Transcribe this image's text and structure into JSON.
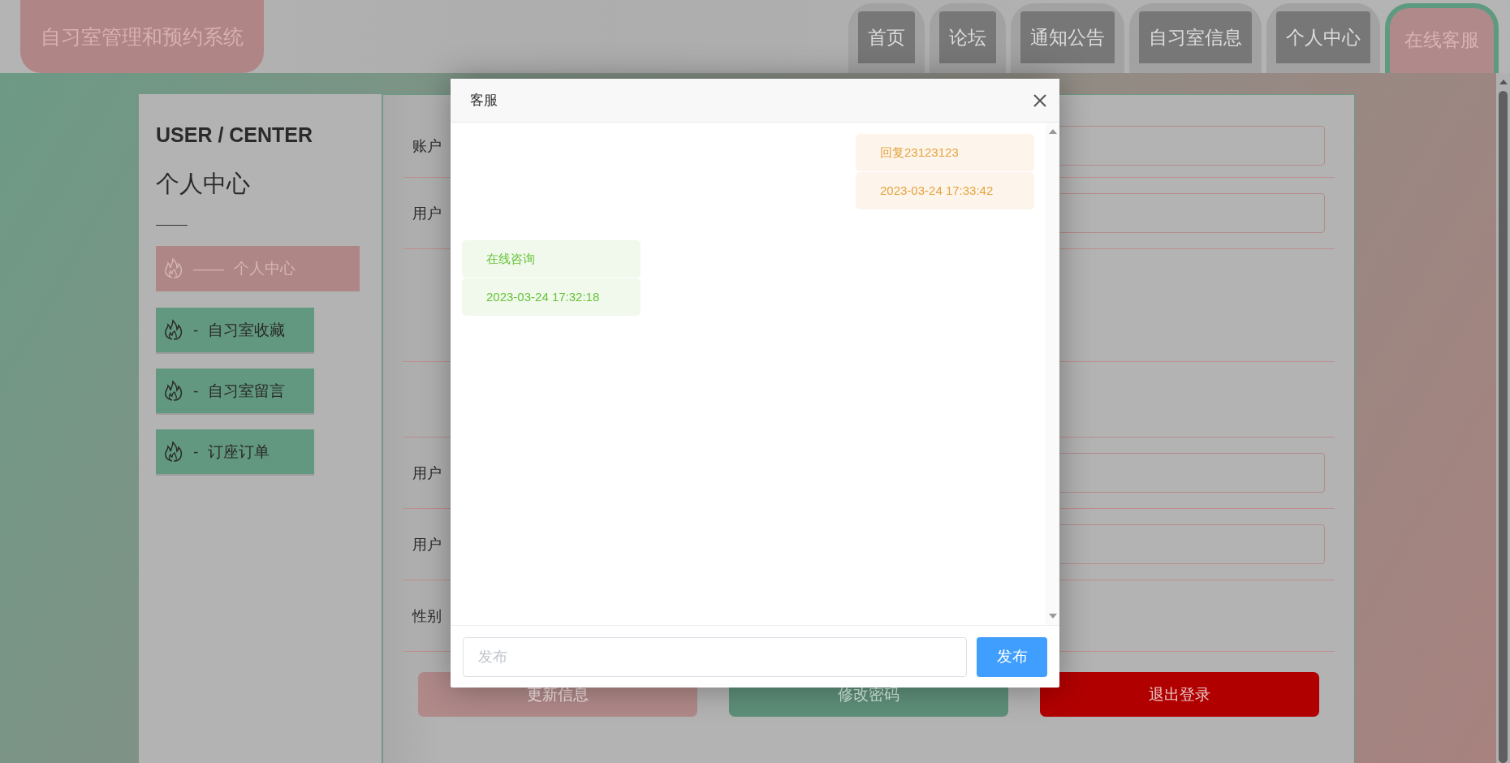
{
  "header": {
    "title": "自习室管理和预约系统",
    "nav": [
      {
        "label": "首页",
        "selected": false
      },
      {
        "label": "论坛",
        "selected": false
      },
      {
        "label": "通知公告",
        "selected": false
      },
      {
        "label": "自习室信息",
        "selected": false
      },
      {
        "label": "个人中心",
        "selected": false
      },
      {
        "label": "在线客服",
        "selected": true
      }
    ]
  },
  "sidebar": {
    "heading": "USER / CENTER",
    "subtitle": "个人中心",
    "items": [
      {
        "dash": "——",
        "label": "个人中心",
        "selected": true
      },
      {
        "dash": "-",
        "label": "自习室收藏",
        "selected": false
      },
      {
        "dash": "-",
        "label": "自习室留言",
        "selected": false
      },
      {
        "dash": "-",
        "label": "订座订单",
        "selected": false
      }
    ]
  },
  "form": {
    "rows": [
      {
        "kind": "input",
        "label": "账户"
      },
      {
        "kind": "input",
        "label": "用户"
      },
      {
        "kind": "area"
      },
      {
        "kind": "empty"
      },
      {
        "kind": "input",
        "label": "用户"
      },
      {
        "kind": "input",
        "label": "用户"
      },
      {
        "kind": "text",
        "label": "性别"
      }
    ],
    "buttons": [
      {
        "kind": "update",
        "label": "更新信息"
      },
      {
        "kind": "password",
        "label": "修改密码"
      },
      {
        "kind": "logout",
        "label": "退出登录"
      }
    ]
  },
  "dialog": {
    "title": "客服",
    "messages": [
      {
        "kind": "sent",
        "text": "回复23123123",
        "time": "2023-03-24 17:33:42"
      },
      {
        "kind": "received",
        "text": "在线咨询",
        "time": "2023-03-24 17:32:18"
      }
    ],
    "input": {
      "placeholder": "发布"
    },
    "send": "发布"
  }
}
